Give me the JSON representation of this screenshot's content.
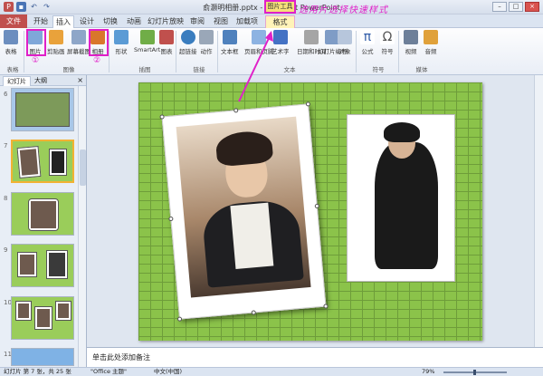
{
  "window": {
    "title": "俞灏明相册.pptx - Microsoft PowerPoint",
    "controls": {
      "minimize": "–",
      "maximize": "□",
      "close": "×"
    }
  },
  "qat": {
    "icons": [
      "powerpoint-icon",
      "save-icon",
      "undo-icon",
      "redo-icon"
    ]
  },
  "tabs": [
    "文件",
    "开始",
    "插入",
    "设计",
    "切换",
    "动画",
    "幻灯片放映",
    "审阅",
    "视图",
    "加载项",
    "格式"
  ],
  "contextual_tab": "图片工具",
  "annotation": "选用片选择快速样式",
  "ribbon": {
    "buttons": [
      {
        "label": "表格",
        "icon": "table-icon"
      },
      {
        "label": "图片",
        "icon": "picture-icon"
      },
      {
        "label": "剪贴画",
        "icon": "clipart-icon"
      },
      {
        "label": "屏幕截图",
        "icon": "screenshot-icon"
      },
      {
        "label": "相册",
        "icon": "photo-album-icon"
      },
      {
        "label": "形状",
        "icon": "shapes-icon"
      },
      {
        "label": "SmartArt",
        "icon": "smartart-icon"
      },
      {
        "label": "图表",
        "icon": "chart-icon"
      },
      {
        "label": "超链接",
        "icon": "hyperlink-icon"
      },
      {
        "label": "动作",
        "icon": "action-icon"
      },
      {
        "label": "文本框",
        "icon": "textbox-icon"
      },
      {
        "label": "页眉和页脚",
        "icon": "header-footer-icon"
      },
      {
        "label": "艺术字",
        "icon": "wordart-icon"
      },
      {
        "label": "日期和时间",
        "icon": "datetime-icon"
      },
      {
        "label": "幻灯片编号",
        "icon": "slide-number-icon"
      },
      {
        "label": "对象",
        "icon": "object-icon"
      },
      {
        "label": "公式",
        "icon": "equation-icon"
      },
      {
        "label": "符号",
        "icon": "symbol-icon"
      },
      {
        "label": "视频",
        "icon": "video-icon"
      },
      {
        "label": "音频",
        "icon": "audio-icon"
      }
    ],
    "groups": [
      "表格",
      "图像",
      "插图",
      "链接",
      "文本",
      "符号",
      "媒体"
    ],
    "markers": [
      "①",
      "②"
    ]
  },
  "pane": {
    "tabs": [
      "幻灯片",
      "大纲"
    ],
    "close": "×",
    "slides": [
      {
        "num": "6"
      },
      {
        "num": "7"
      },
      {
        "num": "8"
      },
      {
        "num": "9"
      },
      {
        "num": "10"
      },
      {
        "num": "11"
      }
    ]
  },
  "notes": {
    "placeholder": "单击此处添加备注"
  },
  "status": {
    "slide_info": "幻灯片 第 7 张，共 25 张",
    "theme": "\"Office 主题\"",
    "language": "中文(中国)",
    "zoom": "79%",
    "zoom_level": 0.79
  },
  "colors": {
    "accent": "#e020c8",
    "file_tab": "#c0504d",
    "slide_bg": "#8bc34a"
  }
}
